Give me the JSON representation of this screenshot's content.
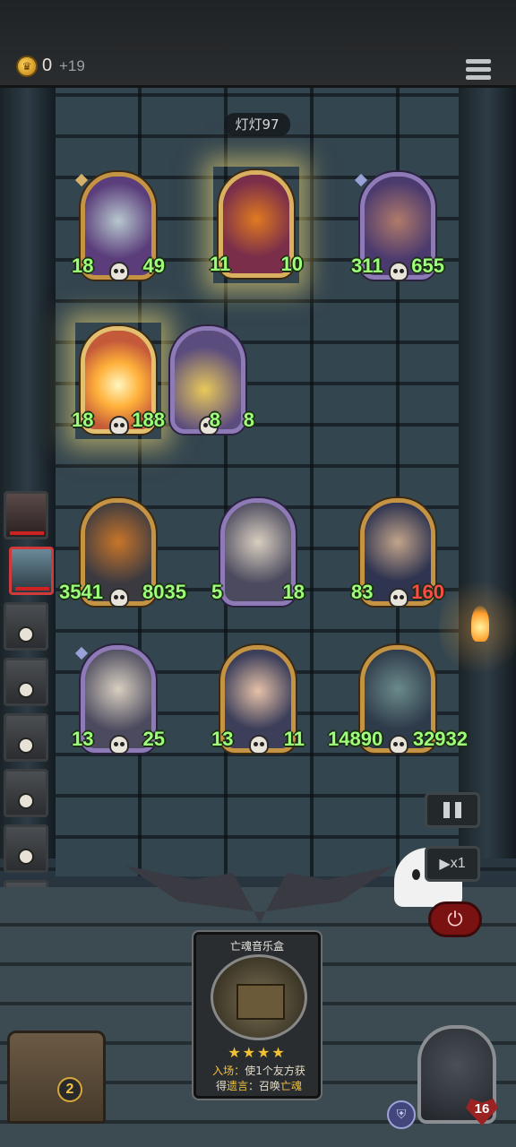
{
  "topbar": {
    "gold": "0",
    "gold_income": "+19"
  },
  "opponent": {
    "name": "灯灯97"
  },
  "enemy_board": [
    {
      "name": "robot-minion",
      "atk": "18",
      "hp": "49"
    },
    {
      "name": "pumpkin-minion",
      "atk": "11",
      "hp": "10"
    },
    {
      "name": "brute-minion",
      "atk": "311",
      "hp": "655"
    },
    {
      "name": "fire-minion",
      "atk": "18",
      "hp": "188"
    },
    {
      "name": "gold-robot-minion",
      "atk": "8",
      "hp": "8"
    }
  ],
  "player_board": [
    {
      "name": "pumpkin-mummy-minion",
      "atk": "3541",
      "hp": "8035"
    },
    {
      "name": "old-witch-minion",
      "atk": "5",
      "hp": "18"
    },
    {
      "name": "hooded-thief-minion",
      "atk": "83",
      "hp": "160"
    },
    {
      "name": "old-witch-minion-2",
      "atk": "13",
      "hp": "25"
    },
    {
      "name": "dark-hair-girl-minion",
      "atk": "13",
      "hp": "11"
    },
    {
      "name": "frankenstein-minion",
      "atk": "14890",
      "hp": "32932"
    }
  ],
  "controls": {
    "speed": "x1",
    "pause": "",
    "power": "⏻"
  },
  "spell_card": {
    "title": "亡魂音乐盒",
    "stars": "★★★★",
    "line1_prefix": "入场：",
    "line1": "使1个友方获",
    "line2_prefix": "得",
    "line2_kw": "遗言",
    "line2_mid": "：召唤",
    "line2_kw2": "亡魂"
  },
  "chest": {
    "count": "2"
  },
  "hero": {
    "hp": "16"
  },
  "colors": {
    "stat_green": "#9dff7a",
    "gold_frame": "#c49444",
    "purple_frame": "#8f7ab8",
    "keyword": "#f0c040"
  }
}
